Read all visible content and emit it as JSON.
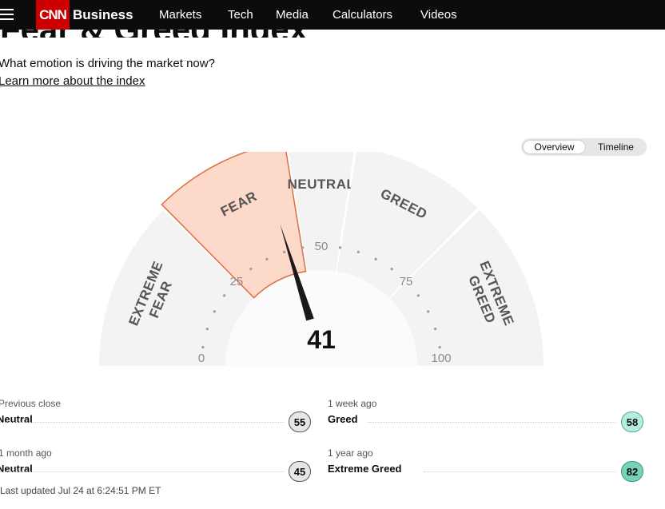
{
  "nav": {
    "brand_logo": "CNN",
    "brand": "Business",
    "links": [
      "Markets",
      "Tech",
      "Media",
      "Calculators",
      "Videos"
    ]
  },
  "header": {
    "title": "Fear & Greed Index",
    "subtitle": "What emotion is driving the market now?",
    "learn_more": "Learn more about the index"
  },
  "toggle": {
    "overview": "Overview",
    "timeline": "Timeline",
    "active": "Overview"
  },
  "gauge": {
    "score": "41",
    "score_value": 41,
    "range": [
      0,
      100
    ],
    "active_segment": "fear",
    "segments": [
      {
        "key": "extreme_fear",
        "lines": [
          "EXTREME",
          "FEAR"
        ],
        "from": 0,
        "to": 25
      },
      {
        "key": "fear",
        "lines": [
          "FEAR"
        ],
        "from": 25,
        "to": 45
      },
      {
        "key": "neutral",
        "lines": [
          "NEUTRAL"
        ],
        "from": 45,
        "to": 55
      },
      {
        "key": "greed",
        "lines": [
          "GREED"
        ],
        "from": 55,
        "to": 75
      },
      {
        "key": "extreme_greed",
        "lines": [
          "EXTREME",
          "GREED"
        ],
        "from": 75,
        "to": 100
      }
    ],
    "ticks": [
      "0",
      "25",
      "50",
      "75",
      "100"
    ],
    "colors": {
      "fear_fill": "#fcd9c9",
      "fear_stroke": "#d9703f",
      "track": "#f3f3f3",
      "needle": "#1a1a1a"
    }
  },
  "stats": {
    "previous_close": {
      "label": "Previous close",
      "value": "Neutral",
      "score": "55"
    },
    "week_ago": {
      "label": "1 week ago",
      "value": "Greed",
      "score": "58"
    },
    "month_ago": {
      "label": "1 month ago",
      "value": "Neutral",
      "score": "45"
    },
    "year_ago": {
      "label": "1 year ago",
      "value": "Extreme Greed",
      "score": "82"
    }
  },
  "badge_colors": {
    "neutral": "#e6e6e6",
    "greed": "#b6ece0",
    "extreme_greed": "#77d2b8"
  },
  "updated": "Last updated Jul 24 at 6:24:51 PM ET"
}
